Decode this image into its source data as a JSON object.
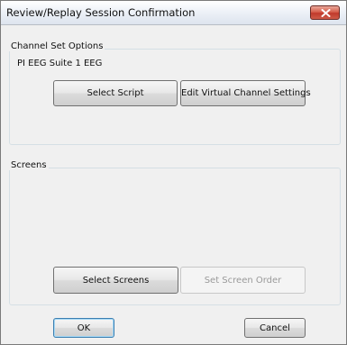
{
  "dialog": {
    "title": "Review/Replay Session Confirmation",
    "close_icon": "close-x-icon"
  },
  "channel_set": {
    "group_label": "Channel Set Options",
    "channel_set_name": "PI EEG Suite 1 EEG",
    "select_script_label": "Select Script",
    "edit_virtual_label": "Edit Virtual Channel Settings"
  },
  "screens": {
    "group_label": "Screens",
    "select_screens_label": "Select Screens",
    "set_screen_order_label": "Set Screen Order",
    "set_screen_order_enabled": false
  },
  "footer": {
    "ok_label": "OK",
    "cancel_label": "Cancel"
  },
  "colors": {
    "close_button": "#c0392b",
    "default_button_border": "#3c7fb1",
    "dialog_background": "#f0f0f0"
  }
}
